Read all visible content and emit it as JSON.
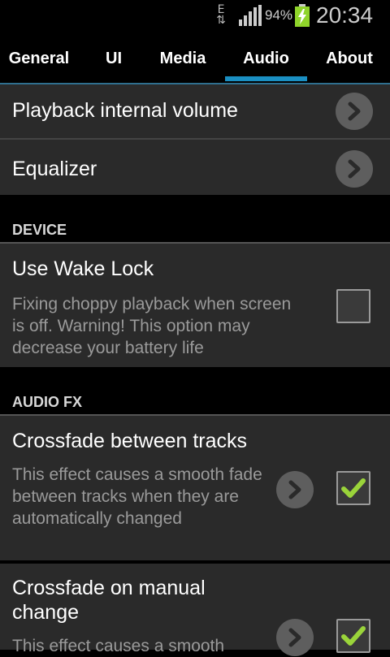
{
  "status_bar": {
    "network_type": "E",
    "battery_percent": "94%",
    "time": "20:34",
    "icons": [
      "data-arrows-icon",
      "signal-icon",
      "battery-charging-icon"
    ]
  },
  "tabs": [
    {
      "label": "General",
      "selected": false
    },
    {
      "label": "UI",
      "selected": false
    },
    {
      "label": "Media",
      "selected": false
    },
    {
      "label": "Audio",
      "selected": true
    },
    {
      "label": "About",
      "selected": false
    }
  ],
  "settings": {
    "playback_volume": {
      "title": "Playback internal volume"
    },
    "equalizer": {
      "title": "Equalizer"
    },
    "device_header": "DEVICE",
    "wake_lock": {
      "title": "Use Wake Lock",
      "summary": "Fixing choppy playback when screen is off. Warning! This option may decrease your battery life",
      "checked": false
    },
    "audio_fx_header": "AUDIO FX",
    "crossfade_tracks": {
      "title": "Crossfade between tracks",
      "summary": "This effect causes a smooth fade between tracks when they are automatically changed",
      "checked": true
    },
    "crossfade_manual": {
      "title": "Crossfade on manual change",
      "summary": "This effect causes a smooth",
      "checked": true
    }
  },
  "colors": {
    "accent": "#1a8fc2",
    "check": "#9ad43a",
    "panel": "#2a2a2a"
  }
}
